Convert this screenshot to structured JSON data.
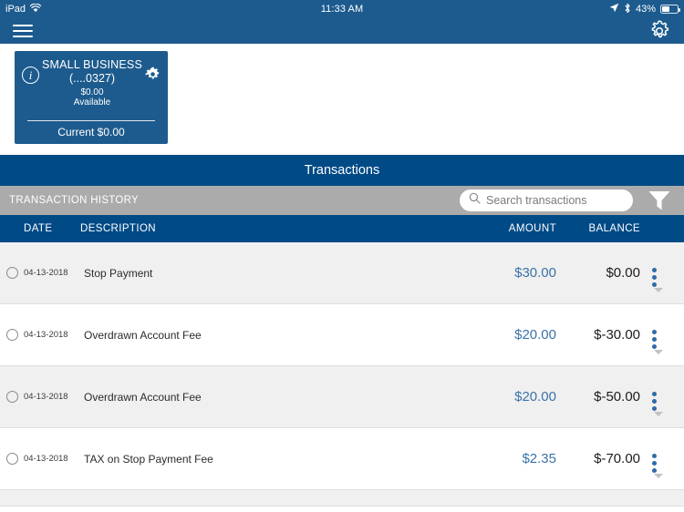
{
  "status_bar": {
    "device": "iPad",
    "wifi_icon": "wifi-icon",
    "time": "11:33 AM",
    "location_icon": "location-arrow-icon",
    "bluetooth_icon": "bluetooth-icon",
    "battery_percent": "43%"
  },
  "nav": {
    "menu_icon": "hamburger-menu-icon",
    "settings_icon": "gear-icon"
  },
  "account_card": {
    "info_icon": "info-circle-icon",
    "name": "SMALL BUSINESS",
    "number": "(....0327)",
    "available_amount": "$0.00",
    "available_label": "Available",
    "current": "Current $0.00",
    "settings_icon": "gear-icon"
  },
  "transactions_header": {
    "title": "Transactions"
  },
  "history_bar": {
    "label": "TRANSACTION HISTORY",
    "search_icon": "search-icon",
    "search_value": "",
    "search_placeholder": "Search transactions",
    "filter_icon": "filter-funnel-icon"
  },
  "table": {
    "columns": {
      "date": "DATE",
      "description": "DESCRIPTION",
      "amount": "AMOUNT",
      "balance": "BALANCE"
    },
    "rows": [
      {
        "date": "04-13-2018",
        "description": "Stop Payment",
        "amount": "$30.00",
        "balance": "$0.00"
      },
      {
        "date": "04-13-2018",
        "description": "Overdrawn Account Fee",
        "amount": "$20.00",
        "balance": "$-30.00"
      },
      {
        "date": "04-13-2018",
        "description": "Overdrawn Account Fee",
        "amount": "$20.00",
        "balance": "$-50.00"
      },
      {
        "date": "04-13-2018",
        "description": "TAX on Stop Payment Fee",
        "amount": "$2.35",
        "balance": "$-70.00"
      }
    ]
  },
  "colors": {
    "nav_blue": "#1d5b8e",
    "header_blue": "#004a86",
    "gray_bar": "#ababab",
    "amount_blue": "#3b72a8",
    "row_alt": "#f0f0f0"
  }
}
